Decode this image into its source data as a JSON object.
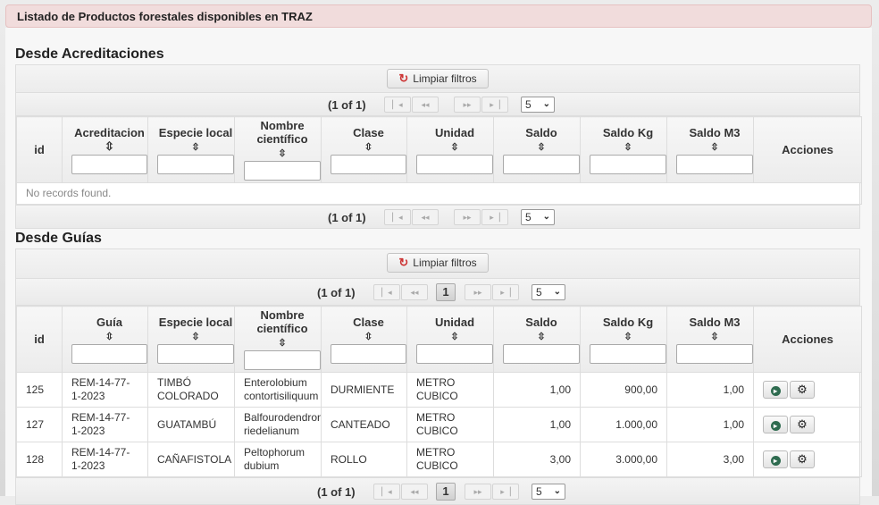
{
  "header": {
    "title": "Listado de Productos forestales disponibles en TRAZ"
  },
  "section1": {
    "title": "Desde Acreditaciones",
    "clear_label": "Limpiar filtros",
    "page_report": "(1 of 1)",
    "rows_per_page": "5",
    "columns": [
      "id",
      "Acreditacion",
      "Especie local",
      "Nombre científico",
      "Clase",
      "Unidad",
      "Saldo",
      "Saldo Kg",
      "Saldo M3",
      "Acciones"
    ],
    "empty_message": "No records found."
  },
  "section2": {
    "title": "Desde Guías",
    "clear_label": "Limpiar filtros",
    "page_report": "(1 of 1)",
    "current_page": "1",
    "rows_per_page": "5",
    "columns": [
      "id",
      "Guía",
      "Especie local",
      "Nombre científico",
      "Clase",
      "Unidad",
      "Saldo",
      "Saldo Kg",
      "Saldo M3",
      "Acciones"
    ],
    "rows": [
      {
        "id": "125",
        "guia": "REM-14-77-1-2023",
        "especie": "TIMBÓ COLORADO",
        "nombre": "Enterolobium contortisiliquum",
        "clase": "DURMIENTE",
        "unidad": "METRO CUBICO",
        "saldo": "1,00",
        "saldo_kg": "900,00",
        "saldo_m3": "1,00"
      },
      {
        "id": "127",
        "guia": "REM-14-77-1-2023",
        "especie": "GUATAMBÚ",
        "nombre": "Balfourodendron riedelianum",
        "clase": "CANTEADO",
        "unidad": "METRO CUBICO",
        "saldo": "1,00",
        "saldo_kg": "1.000,00",
        "saldo_m3": "1,00"
      },
      {
        "id": "128",
        "guia": "REM-14-77-1-2023",
        "especie": "CAÑAFISTOLA",
        "nombre": "Peltophorum dubium",
        "clase": "ROLLO",
        "unidad": "METRO CUBICO",
        "saldo": "3,00",
        "saldo_kg": "3.000,00",
        "saldo_m3": "3,00"
      }
    ]
  },
  "paginator_icons": {
    "first": "first-page-icon",
    "prev": "prev-page-icon",
    "next": "next-page-icon",
    "last": "last-page-icon"
  },
  "action_icons": [
    "arrow-circle-icon",
    "gear-icon"
  ],
  "colors": {
    "header_bg": "#f1dcdc",
    "refresh_icon": "#cc3333",
    "action_circle": "#2e6b4f"
  }
}
